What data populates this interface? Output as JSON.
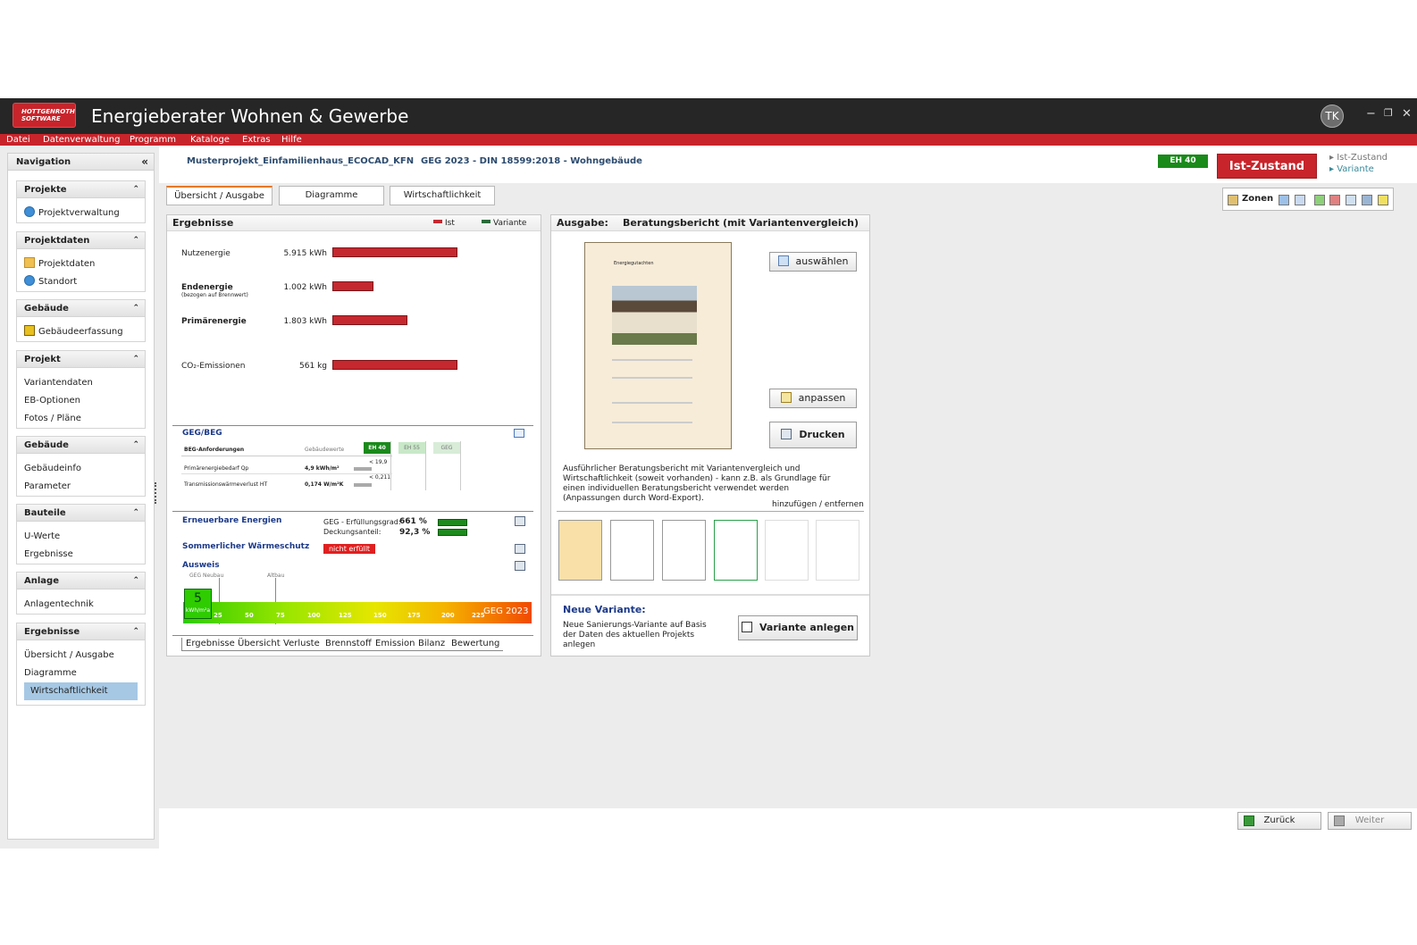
{
  "app": {
    "logo_text": "HOTTGENROTH SOFTWARE",
    "title": "Energieberater Wohnen & Gewerbe",
    "user_initials": "TK",
    "window_controls": {
      "minimize": "−",
      "restore": "❐",
      "close": "✕"
    }
  },
  "menu": [
    "Datei",
    "Datenverwaltung",
    "Programm",
    "Kataloge",
    "Extras",
    "Hilfe"
  ],
  "navigation": {
    "title": "Navigation",
    "collapse_glyph": "«",
    "sections": [
      {
        "title": "Projekte",
        "items": [
          {
            "label": "Projektverwaltung",
            "icon": "globe-icon"
          }
        ]
      },
      {
        "title": "Projektdaten",
        "items": [
          {
            "label": "Projektdaten",
            "icon": "folder-icon"
          },
          {
            "label": "Standort",
            "icon": "globe-icon"
          }
        ]
      },
      {
        "title": "Gebäude",
        "items": [
          {
            "label": "Gebäudeerfassung",
            "icon": "building-icon"
          }
        ]
      },
      {
        "title": "Projekt",
        "items": [
          {
            "label": "Variantendaten"
          },
          {
            "label": "EB-Optionen"
          },
          {
            "label": "Fotos / Pläne"
          }
        ]
      },
      {
        "title": "Gebäude",
        "items": [
          {
            "label": "Gebäudeinfo"
          },
          {
            "label": "Parameter"
          }
        ]
      },
      {
        "title": "Bauteile",
        "items": [
          {
            "label": "U-Werte"
          },
          {
            "label": "Ergebnisse"
          }
        ]
      },
      {
        "title": "Anlage",
        "items": [
          {
            "label": "Anlagentechnik"
          }
        ]
      },
      {
        "title": "Ergebnisse",
        "items": [
          {
            "label": "Übersicht / Ausgabe"
          },
          {
            "label": "Diagramme"
          },
          {
            "label": "Wirtschaftlichkeit",
            "selected": true
          }
        ]
      }
    ]
  },
  "header": {
    "project": "Musterprojekt_Einfamilienhaus_ECOCAD_KFN",
    "norm": "GEG 2023  -  DIN 18599:2018  -  Wohngebäude",
    "badge": "EH 40",
    "state_button": "Ist-Zustand",
    "legend_ist": "▸ Ist-Zustand",
    "legend_variante": "▸ Variante"
  },
  "tabs": [
    "Übersicht / Ausgabe",
    "Diagramme",
    "Wirtschaftlichkeit"
  ],
  "toolbox": {
    "label": "Zonen"
  },
  "results": {
    "title": "Ergebnisse",
    "legend_ist": "Ist",
    "legend_variante": "Variante",
    "rows": [
      {
        "label": "Nutzenergie",
        "sub": "",
        "value": "5.915 kWh",
        "fraction": 1.0
      },
      {
        "label": "Endenergie",
        "sub": "(bezogen auf Brennwert)",
        "value": "1.002 kWh",
        "fraction": 0.33
      },
      {
        "label": "Primärenergie",
        "sub": "",
        "value": "1.803 kWh",
        "fraction": 0.6
      },
      {
        "label": "CO₂-Emissionen",
        "sub": "",
        "value": "561 kg",
        "fraction": 1.0
      }
    ],
    "geg_title": "GEG/BEG",
    "geg_table": {
      "header": [
        "BEG-Anforderungen",
        "Gebäudewerte",
        "EH 40",
        "EH 55",
        "GEG"
      ],
      "rows": [
        {
          "label": "Primärenergiebedarf Qp",
          "value": "4,9 kWh/m²",
          "limit": "< 19,9"
        },
        {
          "label": "Transmissionswärmeverlust HT",
          "value": "0,174 W/m²K",
          "limit": "< 0,211"
        }
      ]
    },
    "erneuerbare_title": "Erneuerbare Energien",
    "geg_erfuellung_label": "GEG - Erfüllungsgrad:",
    "geg_erfuellung_value": "661 %",
    "deckung_label": "Deckungsanteil:",
    "deckung_value": "92,3 %",
    "sommer_title": "Sommerlicher Wärmeschutz",
    "sommer_status": "nicht erfüllt",
    "ausweis_title": "Ausweis",
    "ausweis_marker_neubau": "GEG Neubau",
    "ausweis_marker_altbau": "Altbau",
    "ausweis_value": "5",
    "ausweis_unit": "kWh/m²a",
    "scale_ticks": [
      "25",
      "50",
      "75",
      "100",
      "125",
      "150",
      "175",
      "200",
      "225"
    ],
    "scale_label": "GEG 2023",
    "bottom_tabs": [
      "Ergebnisse",
      "Übersicht",
      "Verluste",
      "Brennstoff",
      "Emission",
      "Bilanz",
      "Bewertung"
    ]
  },
  "output": {
    "title_label": "Ausgabe:",
    "title_value": "Beratungsbericht (mit Variantenvergleich)",
    "doc_title": "Energiegutachten",
    "btn_select": "auswählen",
    "btn_adjust": "anpassen",
    "btn_print": "Drucken",
    "description": "Ausführlicher Beratungsbericht mit Variantenvergleich und Wirtschaftlichkeit (soweit vorhanden) - kann z.B. als Grundlage für einen individuellen Beratungsbericht verwendet werden (Anpassungen durch Word-Export).",
    "add_remove": "hinzufügen / entfernen",
    "new_variant_title": "Neue Variante:",
    "new_variant_text": "Neue Sanierungs-Variante auf Basis der Daten des aktuellen Projekts anlegen",
    "btn_new_variant": "Variante anlegen"
  },
  "footer": {
    "back": "Zurück",
    "next": "Weiter"
  },
  "colors": {
    "brand_red": "#c8242b",
    "eh_green": "#1a8a1a",
    "bar_red": "#c5282f",
    "bar_green": "#1d8a1d"
  }
}
